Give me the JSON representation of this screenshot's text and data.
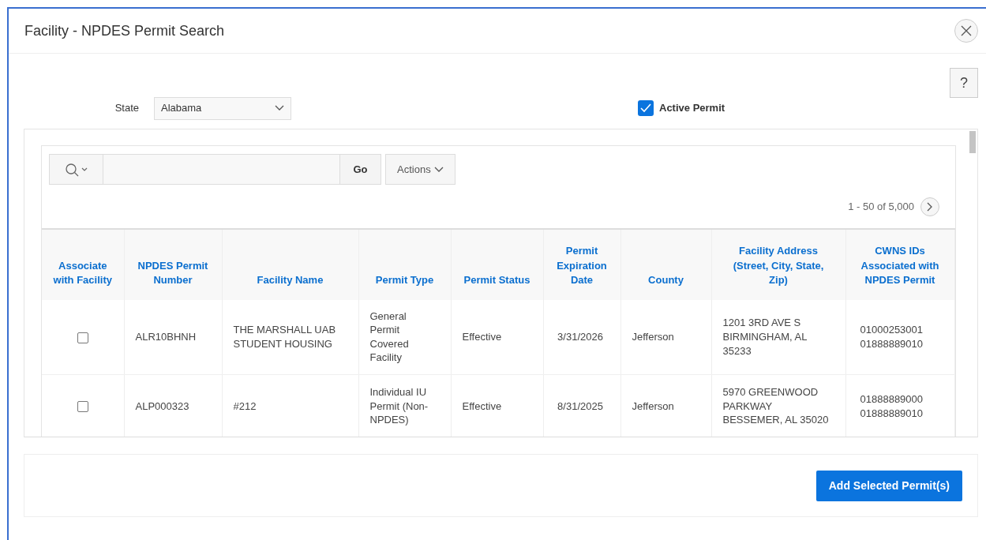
{
  "window": {
    "title": "Facility - NPDES Permit Search"
  },
  "help_button": {
    "label": "?"
  },
  "state_field": {
    "label": "State",
    "value": "Alabama"
  },
  "active_permit": {
    "label": "Active Permit",
    "checked": true
  },
  "toolbar": {
    "go_label": "Go",
    "actions_label": "Actions"
  },
  "pagination": {
    "text": "1 - 50 of 5,000"
  },
  "table": {
    "columns": [
      "Associate with Facility",
      "NPDES Permit Number",
      "Facility Name",
      "Permit Type",
      "Permit Status",
      "Permit Expiration Date",
      "County",
      "Facility Address (Street, City, State, Zip)",
      "CWNS IDs Associated with NPDES Permit"
    ],
    "rows": [
      {
        "associate_checked": false,
        "npdes_permit_number": "ALR10BHNH",
        "facility_name": "THE MARSHALL UAB STUDENT HOUSING",
        "permit_type": "General Permit Covered Facility",
        "permit_status": "Effective",
        "permit_expiration_date": "3/31/2026",
        "county": "Jefferson",
        "facility_address": "1201 3RD AVE S BIRMINGHAM, AL 35233",
        "cwns_ids": [
          "01000253001",
          "01888889010"
        ]
      },
      {
        "associate_checked": false,
        "npdes_permit_number": "ALP000323",
        "facility_name": "#212",
        "permit_type": "Individual IU Permit (Non-NPDES)",
        "permit_status": "Effective",
        "permit_expiration_date": "8/31/2025",
        "county": "Jefferson",
        "facility_address": "5970 GREENWOOD PARKWAY BESSEMER, AL 35020",
        "cwns_ids": [
          "01888889000",
          "01888889010"
        ]
      }
    ]
  },
  "footer": {
    "button": "Add Selected Permit(s)"
  }
}
